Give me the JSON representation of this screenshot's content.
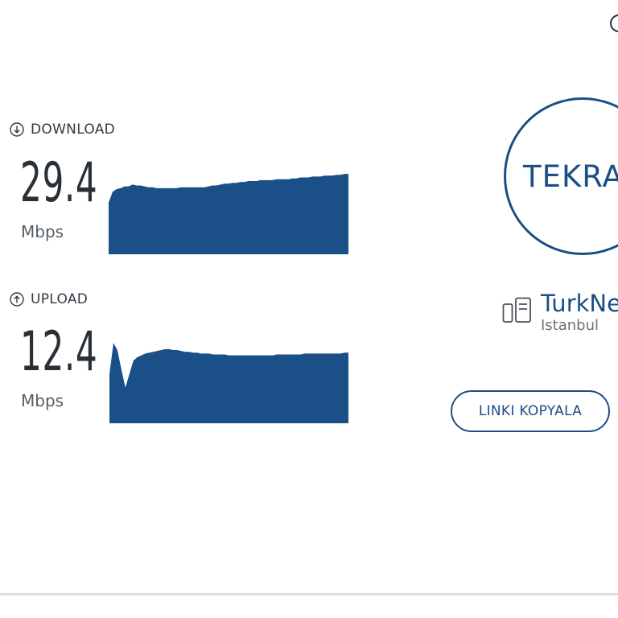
{
  "download": {
    "label": "DOWNLOAD",
    "icon": "arrow-down-circle-icon",
    "value": "29.4",
    "unit": "Mbps",
    "chart_data": {
      "type": "area",
      "values": [
        0.58,
        0.7,
        0.73,
        0.74,
        0.76,
        0.76,
        0.78,
        0.77,
        0.77,
        0.76,
        0.75,
        0.75,
        0.74,
        0.74,
        0.74,
        0.74,
        0.74,
        0.74,
        0.75,
        0.75,
        0.75,
        0.75,
        0.75,
        0.75,
        0.75,
        0.76,
        0.77,
        0.77,
        0.78,
        0.79,
        0.79,
        0.8,
        0.8,
        0.81,
        0.81,
        0.82,
        0.82,
        0.82,
        0.83,
        0.83,
        0.83,
        0.83,
        0.84,
        0.84,
        0.84,
        0.84,
        0.85,
        0.85,
        0.86,
        0.86,
        0.86,
        0.87,
        0.87,
        0.87,
        0.88,
        0.88,
        0.88,
        0.89,
        0.89,
        0.9,
        0.9
      ],
      "color": "#1b4f87"
    }
  },
  "upload": {
    "label": "UPLOAD",
    "icon": "arrow-up-circle-icon",
    "value": "12.4",
    "unit": "Mbps",
    "chart_data": {
      "type": "area",
      "values": [
        0.55,
        0.9,
        0.82,
        0.6,
        0.4,
        0.55,
        0.7,
        0.74,
        0.76,
        0.78,
        0.79,
        0.8,
        0.81,
        0.82,
        0.83,
        0.83,
        0.82,
        0.82,
        0.81,
        0.8,
        0.8,
        0.79,
        0.79,
        0.78,
        0.78,
        0.78,
        0.77,
        0.77,
        0.77,
        0.77,
        0.76,
        0.76,
        0.76,
        0.76,
        0.76,
        0.76,
        0.76,
        0.76,
        0.76,
        0.76,
        0.76,
        0.76,
        0.77,
        0.77,
        0.77,
        0.77,
        0.77,
        0.77,
        0.77,
        0.78,
        0.78,
        0.78,
        0.78,
        0.78,
        0.78,
        0.78,
        0.78,
        0.78,
        0.78,
        0.79,
        0.79
      ],
      "color": "#1b4f87"
    }
  },
  "go_button": {
    "label": "TEKRA"
  },
  "server": {
    "name": "TurkNe",
    "location": "Istanbul",
    "icon": "server-icon"
  },
  "copy_link_button": {
    "label": "LINKI KOPYALA"
  },
  "colors": {
    "accent": "#1b4e85",
    "graph_fill": "#1b4f87"
  }
}
